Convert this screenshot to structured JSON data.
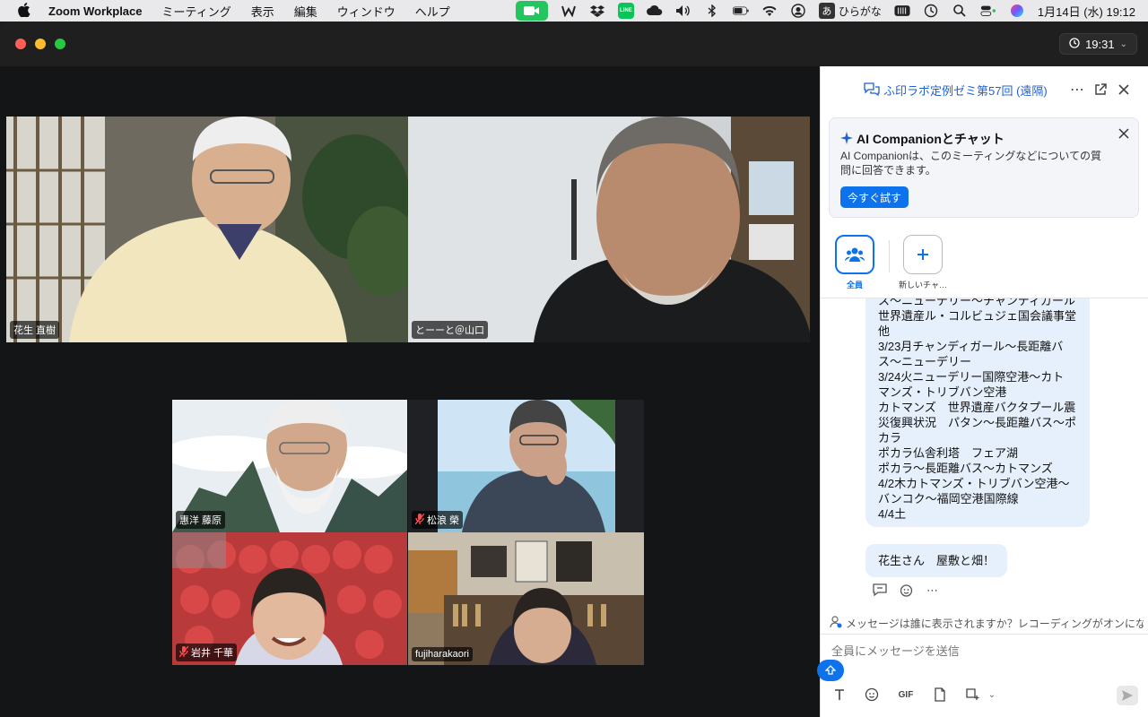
{
  "menubar": {
    "app_name": "Zoom Workplace",
    "items": [
      "ミーティング",
      "表示",
      "編集",
      "ウィンドウ",
      "ヘルプ"
    ],
    "line_label": "LINE",
    "kana_box": "あ",
    "input_mode": "ひらがな",
    "datetime": "1月14日 (水)  19:12"
  },
  "window": {
    "timer": "19:31"
  },
  "participants": [
    {
      "name": "花生 直樹",
      "muted": false
    },
    {
      "name": "とーーと＠山口",
      "muted": false
    },
    {
      "name": "惠洋 藤原",
      "muted": false
    },
    {
      "name": "松浪 榮",
      "muted": true
    },
    {
      "name": "岩井 千華",
      "muted": true
    },
    {
      "name": "fujiharakaori",
      "muted": false
    }
  ],
  "chat": {
    "title": "ふ印ラボ定例ゼミ第57回 (遠隔)",
    "ai": {
      "title": "AI Companionとチャット",
      "desc": "AI Companionは、このミーティングなどについての質問に回答できます。",
      "button": "今すぐ試す"
    },
    "recipients": {
      "all": "全員",
      "new": "新しいチャ…"
    },
    "messages": [
      {
        "lines": [
          "ス〜ニューデリー〜チャンディガール",
          "世界遺産ル・コルビュジェ国会議事堂",
          "他",
          "3/23月チャンディガール〜長距離バ",
          "ス〜ニューデリー",
          "3/24火ニューデリー国際空港〜カト",
          "マンズ・トリブバン空港",
          "カトマンズ　世界遺産バクタプール震",
          "災復興状況　パタン〜長距離バス〜ポ",
          "カラ",
          "ポカラ仏舎利塔　フェア湖",
          "ポカラ〜長距離バス〜カトマンズ",
          "4/2木カトマンズ・トリブバン空港〜",
          "バンコク〜福岡空港国際線",
          "4/4土"
        ]
      },
      {
        "lines": [
          "花生さん　屋敷と畑！"
        ]
      }
    ],
    "notice": "メッセージは誰に表示されますか？レコーディングがオンにな…",
    "input_placeholder": "全員にメッセージを送信",
    "toolbar": {
      "gif": "GIF"
    }
  },
  "colors": {
    "accent": "#0e72ed",
    "title_blue": "#1f61d1",
    "bubble": "#e6f0fc",
    "zoom_green": "#22c55e",
    "mute_red": "#ff4d4d"
  }
}
